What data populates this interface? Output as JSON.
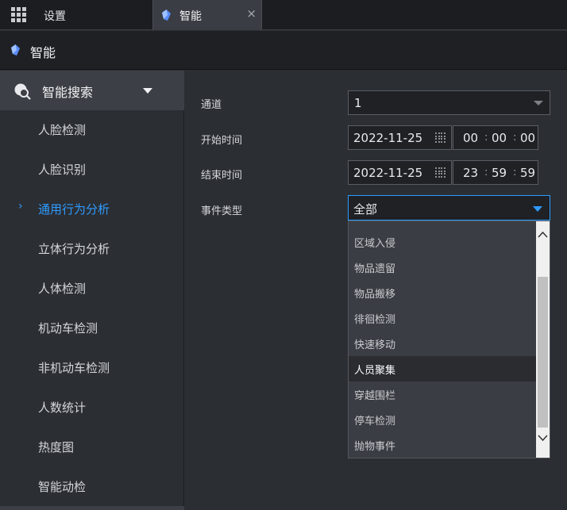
{
  "tabs": {
    "settings_label": "设置",
    "active_label": "智能",
    "close_glyph": "×"
  },
  "header": {
    "title": "智能"
  },
  "sidebar": {
    "section_label": "智能搜索",
    "items": [
      {
        "label": "人脸检测",
        "active": false
      },
      {
        "label": "人脸识别",
        "active": false
      },
      {
        "label": "通用行为分析",
        "active": true
      },
      {
        "label": "立体行为分析",
        "active": false
      },
      {
        "label": "人体检测",
        "active": false
      },
      {
        "label": "机动车检测",
        "active": false
      },
      {
        "label": "非机动车检测",
        "active": false
      },
      {
        "label": "人数统计",
        "active": false
      },
      {
        "label": "热度图",
        "active": false
      },
      {
        "label": "智能动检",
        "active": false
      }
    ],
    "active_marker": "›"
  },
  "form": {
    "channel": {
      "label": "通道",
      "value": "1"
    },
    "start": {
      "label": "开始时间",
      "date": "2022-11-25",
      "hh": "00",
      "mm": "00",
      "ss": "00"
    },
    "end": {
      "label": "结束时间",
      "date": "2022-11-25",
      "hh": "23",
      "mm": "59",
      "ss": "59"
    },
    "event_type": {
      "label": "事件类型",
      "value": "全部"
    },
    "time_sep": ":"
  },
  "event_dropdown": {
    "options": [
      "区域入侵",
      "物品遗留",
      "物品搬移",
      "徘徊检测",
      "快速移动",
      "人员聚集",
      "穿越围栏",
      "停车检测",
      "抛物事件"
    ],
    "hovered": "人员聚集"
  },
  "colors": {
    "accent": "#2f9bff",
    "tab_active_bg": "#3a3d43",
    "sidebar_head_bg": "#3c3f45"
  },
  "icons": {
    "apps": "grid-icon",
    "module": "gem-icon",
    "search": "search-icon",
    "calendar": "calendar-icon"
  }
}
